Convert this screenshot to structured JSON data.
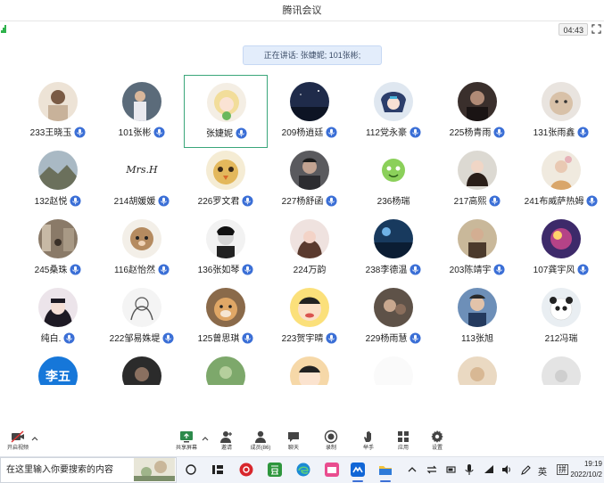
{
  "window": {
    "title": "腾讯会议"
  },
  "status": {
    "timer": "04:43"
  },
  "speaking": {
    "label": "正在讲话:",
    "names": "张婕妮; 101张彬;"
  },
  "colors": {
    "accent": "#3b6fd6",
    "active_border": "#3aa67a",
    "mic": "#3b6fd6"
  },
  "participants": [
    {
      "name": "233王晓玉",
      "mic": true,
      "avatar": "photo-woman"
    },
    {
      "name": "101张彬",
      "mic": true,
      "avatar": "photo-basketball"
    },
    {
      "name": "张婕妮",
      "mic": true,
      "avatar": "anime-blonde",
      "active": true
    },
    {
      "name": "209杨逍廷",
      "mic": true,
      "avatar": "night-sky"
    },
    {
      "name": "112党永豪",
      "mic": true,
      "avatar": "anime-boy"
    },
    {
      "name": "225杨青雨",
      "mic": true,
      "avatar": "photo-dark"
    },
    {
      "name": "131张雨鑫",
      "mic": true,
      "avatar": "cat"
    },
    {
      "name": "132赵悦",
      "mic": true,
      "avatar": "landscape"
    },
    {
      "name": "214胡媛媛",
      "mic": true,
      "avatar": "signature",
      "avatar_text": "Mrs.H"
    },
    {
      "name": "226罗文君",
      "mic": true,
      "avatar": "chick"
    },
    {
      "name": "227杨舒函",
      "mic": true,
      "avatar": "photo-boy"
    },
    {
      "name": "236杨瑞",
      "mic": false,
      "avatar": "cartoon-green"
    },
    {
      "name": "217高熙",
      "mic": true,
      "avatar": "photo-girl"
    },
    {
      "name": "241布威萨热姆",
      "mic": true,
      "avatar": "photo-girl2"
    },
    {
      "name": "245桑珠",
      "mic": true,
      "avatar": "photo-street"
    },
    {
      "name": "116赵怡然",
      "mic": true,
      "avatar": "cartoon-bear"
    },
    {
      "name": "136张如琴",
      "mic": true,
      "avatar": "bw-boy"
    },
    {
      "name": "224万韵",
      "mic": false,
      "avatar": "photo-girl3"
    },
    {
      "name": "238李德温",
      "mic": true,
      "avatar": "night-blue"
    },
    {
      "name": "203陈靖宇",
      "mic": true,
      "avatar": "photo-man"
    },
    {
      "name": "107龚宇风",
      "mic": true,
      "avatar": "galaxy"
    },
    {
      "name": "纯白.",
      "mic": true,
      "avatar": "anime-dark"
    },
    {
      "name": "222邹易姝堤",
      "mic": true,
      "avatar": "sketch"
    },
    {
      "name": "125曾思琪",
      "mic": true,
      "avatar": "dog"
    },
    {
      "name": "223贺宇晴",
      "mic": true,
      "avatar": "shinchan"
    },
    {
      "name": "229杨雨慧",
      "mic": true,
      "avatar": "photo-dim"
    },
    {
      "name": "113张旭",
      "mic": false,
      "avatar": "photo-blue"
    },
    {
      "name": "212冯瑞",
      "mic": false,
      "avatar": "panda"
    },
    {
      "name": "",
      "mic": false,
      "avatar": "blue-text",
      "avatar_text": "李五"
    },
    {
      "name": "",
      "mic": false,
      "avatar": "photo-dark2"
    },
    {
      "name": "",
      "mic": false,
      "avatar": "green"
    },
    {
      "name": "",
      "mic": false,
      "avatar": "shinchan2"
    },
    {
      "name": "",
      "mic": false,
      "avatar": "white"
    },
    {
      "name": "",
      "mic": false,
      "avatar": "beige"
    },
    {
      "name": "",
      "mic": false,
      "avatar": "gray"
    }
  ],
  "toolbar": {
    "video": "开启视频",
    "share": "共享屏幕",
    "invite": "邀请",
    "members": "成员(86)",
    "chat": "聊天",
    "record": "录制",
    "hand": "举手",
    "apps": "应用",
    "settings": "设置"
  },
  "taskbar": {
    "search_placeholder": "在这里输入你要搜索的内容",
    "lang": "英",
    "ime": "拼",
    "time": "19:19",
    "date": "2022/10/2"
  }
}
